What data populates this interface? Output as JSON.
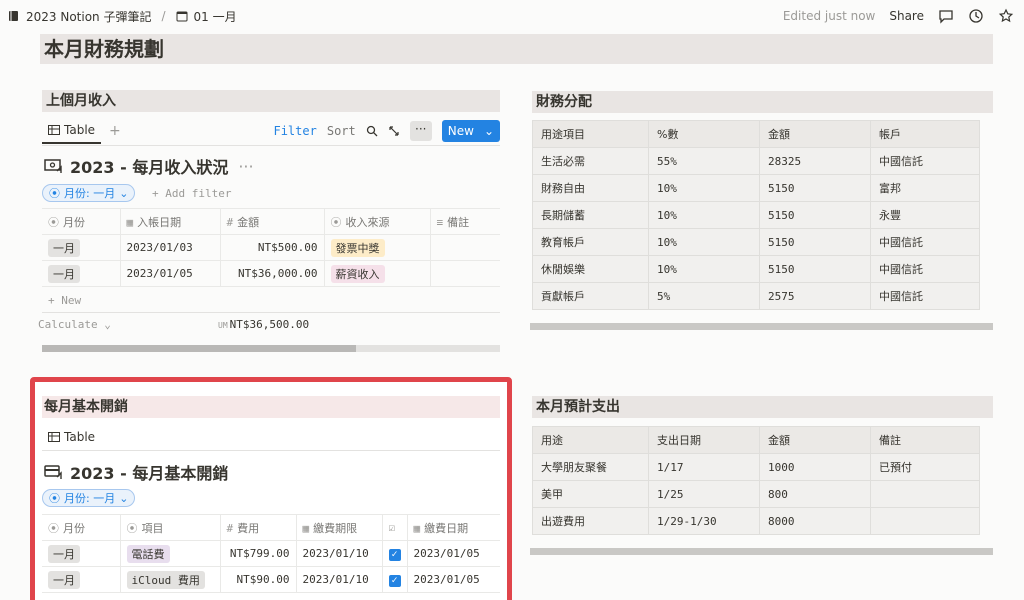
{
  "topbar": {
    "breadcrumb_1": "2023 Notion 子彈筆記",
    "breadcrumb_2": "01 一月",
    "edited": "Edited just now",
    "share": "Share"
  },
  "page_title": "本月財務規劃",
  "income": {
    "section_title": "上個月收入",
    "tab_label": "Table",
    "filter": "Filter",
    "sort": "Sort",
    "new": "New",
    "db_title": "2023 - 每月收入狀況",
    "chip": "月份: 一月",
    "add_filter": "+ Add filter",
    "headers": [
      "月份",
      "入帳日期",
      "金額",
      "收入來源",
      "備註"
    ],
    "rows": [
      {
        "month": "一月",
        "date": "2023/01/03",
        "amount": "NT$500.00",
        "source": "發票中獎"
      },
      {
        "month": "一月",
        "date": "2023/01/05",
        "amount": "NT$36,000.00",
        "source": "薪資收入"
      }
    ],
    "new_row": "+ New",
    "calculate": "Calculate",
    "sum_prefix": "UM",
    "sum": "NT$36,500.00"
  },
  "allocation": {
    "section_title": "財務分配",
    "headers": [
      "用途項目",
      "%數",
      "金額",
      "帳戶"
    ],
    "rows": [
      [
        "生活必需",
        "55%",
        "28325",
        "中國信託"
      ],
      [
        "財務自由",
        "10%",
        "5150",
        "富邦"
      ],
      [
        "長期儲蓄",
        "10%",
        "5150",
        "永豐"
      ],
      [
        "教育帳戶",
        "10%",
        "5150",
        "中國信託"
      ],
      [
        "休閒娛樂",
        "10%",
        "5150",
        "中國信託"
      ],
      [
        "貢獻帳戶",
        "5%",
        "2575",
        "中國信託"
      ]
    ]
  },
  "expenses": {
    "section_title": "每月基本開銷",
    "tab_label": "Table",
    "db_title": "2023 - 每月基本開銷",
    "chip": "月份: 一月",
    "headers": [
      "月份",
      "項目",
      "費用",
      "繳費期限",
      "",
      "繳費日期"
    ],
    "rows": [
      {
        "month": "一月",
        "item": "電話費",
        "cost": "NT$799.00",
        "due": "2023/01/10",
        "paid": "2023/01/05"
      },
      {
        "month": "一月",
        "item": "iCloud 費用",
        "cost": "NT$90.00",
        "due": "2023/01/10",
        "paid": "2023/01/05"
      }
    ]
  },
  "planned": {
    "section_title": "本月預計支出",
    "headers": [
      "用途",
      "支出日期",
      "金額",
      "備註"
    ],
    "rows": [
      [
        "大學朋友聚餐",
        "1/17",
        "1000",
        "已預付"
      ],
      [
        "美甲",
        "1/25",
        "800",
        ""
      ],
      [
        "出遊費用",
        "1/29-1/30",
        "8000",
        ""
      ]
    ]
  }
}
